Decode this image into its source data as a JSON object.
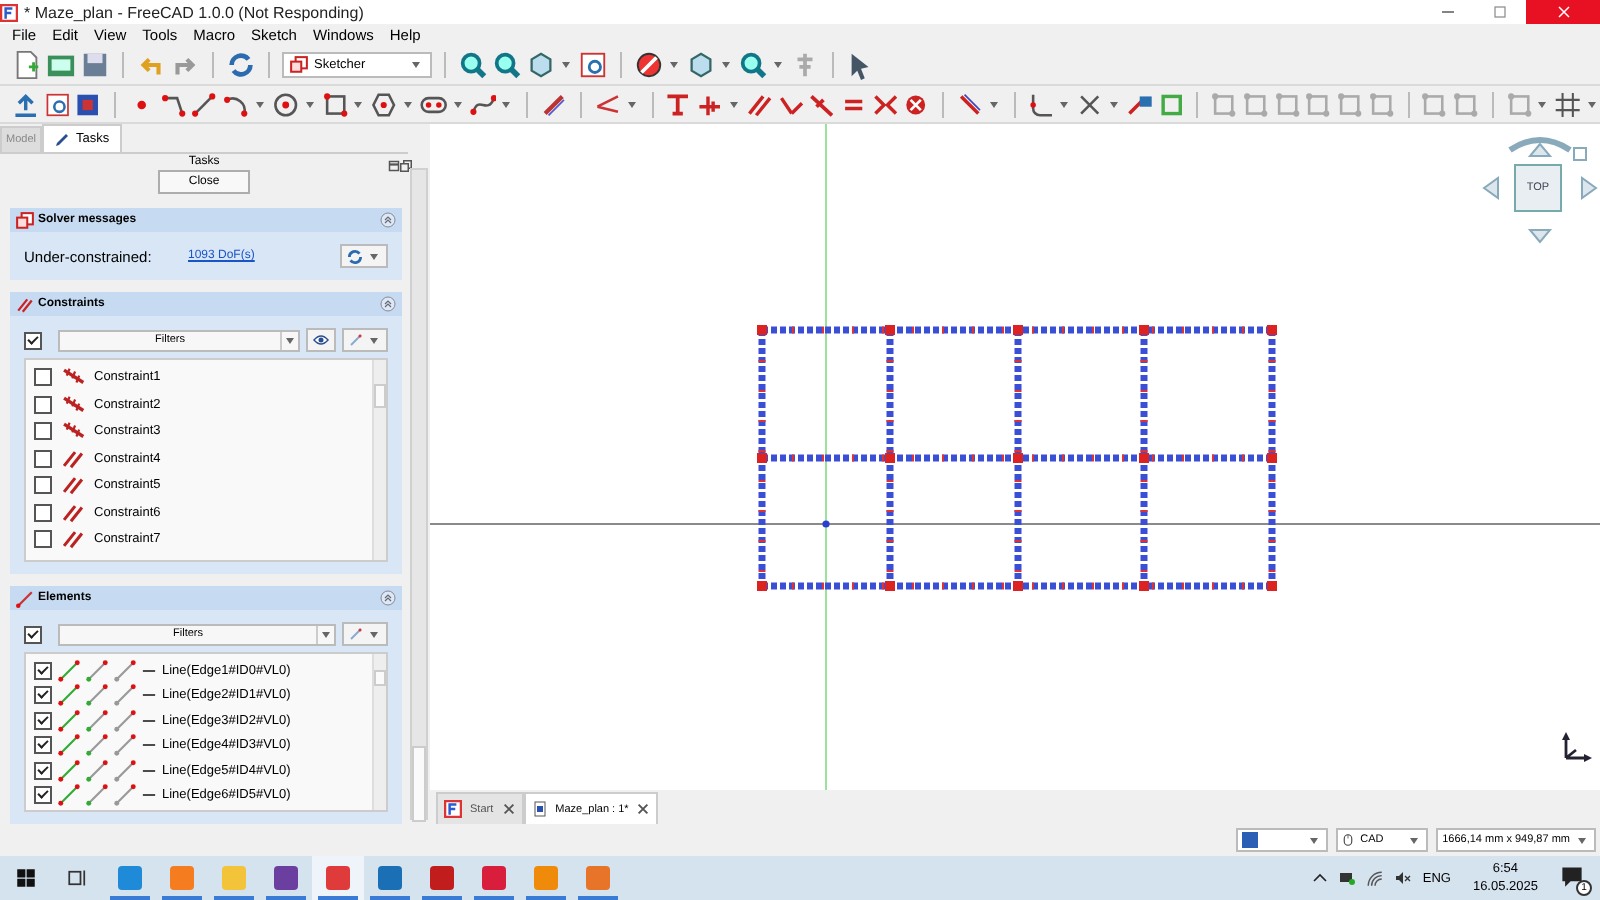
{
  "window": {
    "title": "* Maze_plan - FreeCAD 1.0.0 (Not Responding)"
  },
  "menu": [
    "File",
    "Edit",
    "View",
    "Tools",
    "Macro",
    "Sketch",
    "Windows",
    "Help"
  ],
  "toolbar": {
    "workbench": "Sketcher"
  },
  "combo_view": {
    "tabs": [
      {
        "label": "Model",
        "selected": false
      },
      {
        "label": "Tasks",
        "selected": true
      }
    ],
    "title": "Tasks",
    "close_button": "Close",
    "solver_messages": {
      "title": "Solver messages",
      "status": "Under-constrained:",
      "link": "1093 DoF(s)"
    },
    "constraints": {
      "title": "Constraints",
      "filter": "Filters",
      "all_checked": true,
      "items": [
        {
          "label": "Constraint1",
          "kind": "coincident",
          "checked": false
        },
        {
          "label": "Constraint2",
          "kind": "coincident",
          "checked": false
        },
        {
          "label": "Constraint3",
          "kind": "coincident",
          "checked": false
        },
        {
          "label": "Constraint4",
          "kind": "parallel",
          "checked": false
        },
        {
          "label": "Constraint5",
          "kind": "parallel",
          "checked": false
        },
        {
          "label": "Constraint6",
          "kind": "parallel",
          "checked": false
        },
        {
          "label": "Constraint7",
          "kind": "parallel",
          "checked": false
        }
      ]
    },
    "elements": {
      "title": "Elements",
      "filter": "Filters",
      "all_checked": true,
      "items": [
        {
          "label": "Line(Edge1#ID0#VL0)",
          "checked": true
        },
        {
          "label": "Line(Edge2#ID1#VL0)",
          "checked": true
        },
        {
          "label": "Line(Edge3#ID2#VL0)",
          "checked": true
        },
        {
          "label": "Line(Edge4#ID3#VL0)",
          "checked": true
        },
        {
          "label": "Line(Edge5#ID4#VL0)",
          "checked": true
        },
        {
          "label": "Line(Edge6#ID5#VL0)",
          "checked": true
        }
      ]
    }
  },
  "view": {
    "nav_cube": "TOP"
  },
  "document_tabs": [
    {
      "label": "Start",
      "selected": false
    },
    {
      "label": "Maze_plan : 1*",
      "selected": true
    }
  ],
  "status_bar": {
    "navigation": "CAD",
    "dimensions": "1666,14 mm x 949,87 mm"
  },
  "taskbar": {
    "apps": [
      {
        "color": "#1f8ad8",
        "selected": false
      },
      {
        "color": "#f57c1f",
        "selected": false
      },
      {
        "color": "#f3c33a",
        "selected": false
      },
      {
        "color": "#6b3fa0",
        "selected": false
      },
      {
        "color": "#e03b3b",
        "selected": true
      },
      {
        "color": "#1a6fb5",
        "selected": false
      },
      {
        "color": "#c21d1d",
        "selected": false
      },
      {
        "color": "#d81e3c",
        "selected": false
      },
      {
        "color": "#f08a0b",
        "selected": false
      },
      {
        "color": "#e8742a",
        "selected": false
      }
    ],
    "language": "ENG",
    "time": "6:54",
    "date": "16.05.2025",
    "notifications": "1"
  }
}
